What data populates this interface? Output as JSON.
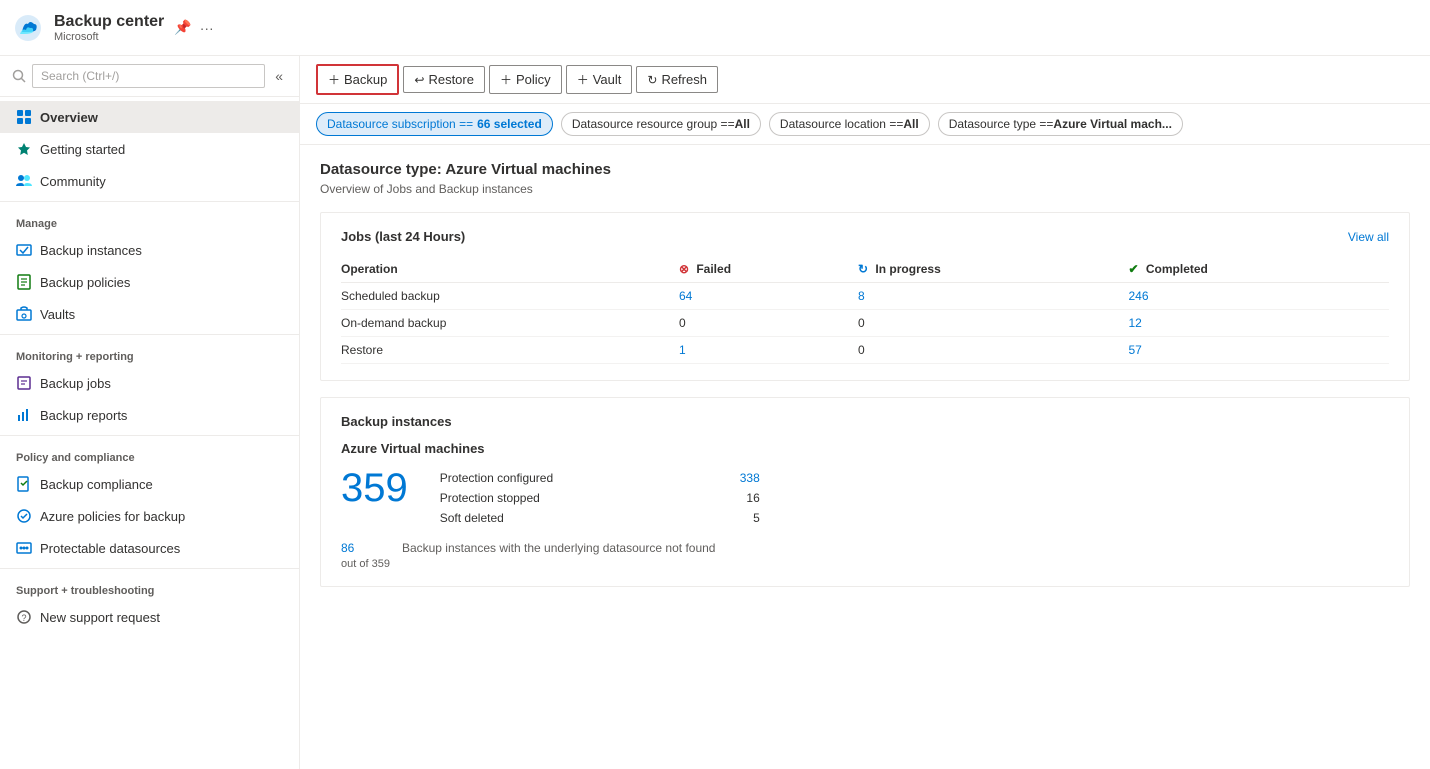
{
  "header": {
    "title": "Backup center",
    "subtitle": "Microsoft",
    "pin_label": "Pin",
    "more_label": "More options"
  },
  "search": {
    "placeholder": "Search (Ctrl+/)"
  },
  "sidebar": {
    "items": [
      {
        "id": "overview",
        "label": "Overview",
        "icon": "overview-icon",
        "active": true
      },
      {
        "id": "getting-started",
        "label": "Getting started",
        "icon": "getting-started-icon",
        "active": false
      },
      {
        "id": "community",
        "label": "Community",
        "icon": "community-icon",
        "active": false
      }
    ],
    "manage_label": "Manage",
    "manage_items": [
      {
        "id": "backup-instances",
        "label": "Backup instances",
        "icon": "backup-instances-icon"
      },
      {
        "id": "backup-policies",
        "label": "Backup policies",
        "icon": "backup-policies-icon"
      },
      {
        "id": "vaults",
        "label": "Vaults",
        "icon": "vaults-icon"
      }
    ],
    "monitoring_label": "Monitoring + reporting",
    "monitoring_items": [
      {
        "id": "backup-jobs",
        "label": "Backup jobs",
        "icon": "backup-jobs-icon"
      },
      {
        "id": "backup-reports",
        "label": "Backup reports",
        "icon": "backup-reports-icon"
      }
    ],
    "policy_label": "Policy and compliance",
    "policy_items": [
      {
        "id": "backup-compliance",
        "label": "Backup compliance",
        "icon": "backup-compliance-icon"
      },
      {
        "id": "azure-policies",
        "label": "Azure policies for backup",
        "icon": "azure-policies-icon"
      },
      {
        "id": "protectable-datasources",
        "label": "Protectable datasources",
        "icon": "protectable-datasources-icon"
      }
    ],
    "support_label": "Support + troubleshooting",
    "support_items": [
      {
        "id": "new-support-request",
        "label": "New support request",
        "icon": "support-icon"
      }
    ]
  },
  "toolbar": {
    "backup_label": "Backup",
    "restore_label": "Restore",
    "policy_label": "Policy",
    "vault_label": "Vault",
    "refresh_label": "Refresh"
  },
  "filters": {
    "subscription_label": "Datasource subscription == ",
    "subscription_value": "66 selected",
    "resource_group_label": "Datasource resource group == ",
    "resource_group_value": "All",
    "location_label": "Datasource location == ",
    "location_value": "All",
    "type_label": "Datasource type == ",
    "type_value": "Azure Virtual mach..."
  },
  "page": {
    "title": "Datasource type: Azure Virtual machines",
    "subtitle": "Overview of Jobs and Backup instances"
  },
  "jobs_card": {
    "title": "Jobs (last 24 Hours)",
    "view_all": "View all",
    "columns": [
      "Operation",
      "Failed",
      "In progress",
      "Completed"
    ],
    "status_failed_label": "Failed",
    "status_inprogress_label": "In progress",
    "status_completed_label": "Completed",
    "rows": [
      {
        "operation": "Scheduled backup",
        "failed": "64",
        "in_progress": "8",
        "completed": "246",
        "failed_plain": false,
        "in_progress_plain": false,
        "completed_plain": false
      },
      {
        "operation": "On-demand backup",
        "failed": "0",
        "in_progress": "0",
        "completed": "12",
        "failed_is_plain": true,
        "in_progress_is_plain": true,
        "completed_plain": false
      },
      {
        "operation": "Restore",
        "failed": "1",
        "in_progress": "0",
        "completed": "57",
        "failed_is_plain": false,
        "in_progress_is_plain": true,
        "completed_plain": false
      }
    ]
  },
  "instances_card": {
    "title": "Backup instances",
    "sub_title": "Azure Virtual machines",
    "count": "359",
    "protection_configured_label": "Protection configured",
    "protection_configured_value": "338",
    "protection_stopped_label": "Protection stopped",
    "protection_stopped_value": "16",
    "soft_deleted_label": "Soft deleted",
    "soft_deleted_value": "5",
    "footer_count": "86",
    "footer_out_of": "out of 359",
    "footer_description": "Backup instances with the underlying datasource not found"
  }
}
